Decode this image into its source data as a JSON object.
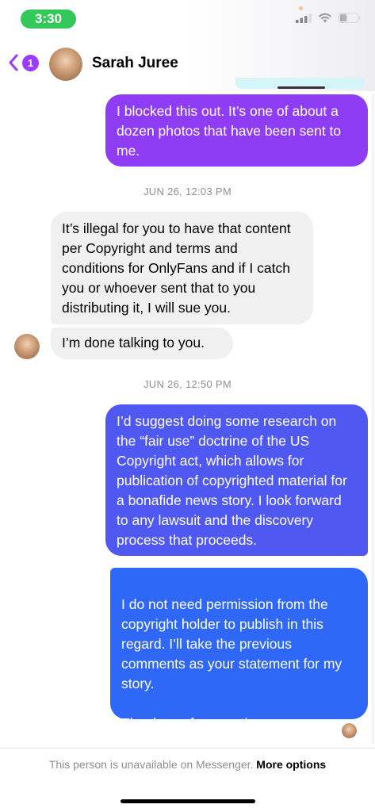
{
  "status_bar": {
    "time": "3:30",
    "battery_level": 0.4
  },
  "header": {
    "back_badge": "1",
    "contact_name": "Sarah Juree"
  },
  "messages": [
    {
      "direction": "outgoing",
      "text": "I blocked this out. It’s one of about a dozen photos that have been sent to me."
    },
    {
      "direction": "incoming",
      "text": "It’s illegal for you to have that content per Copyright and terms and conditions for OnlyFans and if I catch you or whoever sent that to you distributing it, I will sue you."
    },
    {
      "direction": "incoming",
      "text": "I’m done talking to you."
    },
    {
      "direction": "outgoing",
      "text": "I’d suggest doing some research on the “fair use” doctrine of the US Copyright act, which allows for publication of copyrighted material for a bonafide news story. I look forward to any lawsuit and the discovery process that proceeds."
    },
    {
      "direction": "outgoing",
      "text": "I do not need permission from the copyright holder to publish in this regard. I’ll take the previous comments as your statement for my story.\n\nThank you for your time."
    }
  ],
  "timestamps": [
    "JUN 26, 12:03 PM",
    "JUN 26, 12:50 PM"
  ],
  "footer": {
    "note": "This person is unavailable on Messenger.",
    "link": "More options"
  },
  "colors": {
    "accent_purple": "#9b3bfc",
    "bubble_purple": "#8f3df5",
    "bubble_blue_mid": "#4f58f0",
    "bubble_blue": "#2f67f6",
    "incoming_bg": "#f0f0f0",
    "status_green": "#34c759"
  },
  "icons": [
    "back-chevron-icon",
    "cellular-signal-icon",
    "wifi-icon",
    "battery-icon"
  ]
}
